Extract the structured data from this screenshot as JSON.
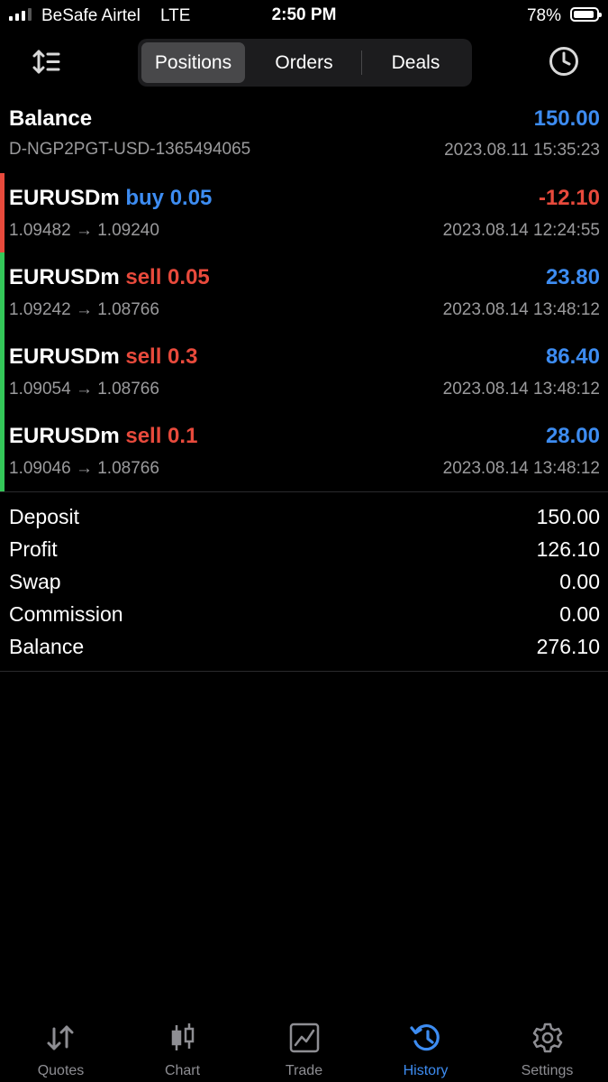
{
  "status_bar": {
    "carrier": "BeSafe Airtel",
    "network": "LTE",
    "time": "2:50 PM",
    "battery_percent": "78%",
    "battery_level": 0.78
  },
  "top_nav": {
    "sort_icon": "sort-icon",
    "clock_icon": "history-clock-icon",
    "tabs": [
      {
        "label": "Positions",
        "active": true
      },
      {
        "label": "Orders",
        "active": false
      },
      {
        "label": "Deals",
        "active": false
      }
    ]
  },
  "balance_entry": {
    "label": "Balance",
    "account": "D-NGP2PGT-USD-1365494065",
    "amount": "150.00",
    "datetime": "2023.08.11 15:35:23"
  },
  "deals": [
    {
      "symbol": "EURUSDm",
      "side_volume": "buy 0.05",
      "side": "buy",
      "prices": "1.09482 → 1.09240",
      "profit": "-12.10",
      "datetime": "2023.08.14 12:24:55"
    },
    {
      "symbol": "EURUSDm",
      "side_volume": "sell 0.05",
      "side": "sell",
      "prices": "1.09242 → 1.08766",
      "profit": "23.80",
      "datetime": "2023.08.14 13:48:12"
    },
    {
      "symbol": "EURUSDm",
      "side_volume": "sell 0.3",
      "side": "sell",
      "prices": "1.09054 → 1.08766",
      "profit": "86.40",
      "datetime": "2023.08.14 13:48:12"
    },
    {
      "symbol": "EURUSDm",
      "side_volume": "sell 0.1",
      "side": "sell",
      "prices": "1.09046 → 1.08766",
      "profit": "28.00",
      "datetime": "2023.08.14 13:48:12"
    }
  ],
  "summary": [
    {
      "label": "Deposit",
      "value": "150.00"
    },
    {
      "label": "Profit",
      "value": "126.10"
    },
    {
      "label": "Swap",
      "value": "0.00"
    },
    {
      "label": "Commission",
      "value": "0.00"
    },
    {
      "label": "Balance",
      "value": "276.10"
    }
  ],
  "tab_bar": [
    {
      "label": "Quotes",
      "icon": "quotes-arrows-icon",
      "active": false
    },
    {
      "label": "Chart",
      "icon": "candlestick-chart-icon",
      "active": false
    },
    {
      "label": "Trade",
      "icon": "trade-chart-icon",
      "active": false
    },
    {
      "label": "History",
      "icon": "history-clock-icon",
      "active": true
    },
    {
      "label": "Settings",
      "icon": "gear-icon",
      "active": false
    }
  ],
  "colors": {
    "blue": "#3d8cf1",
    "red": "#e84a3c",
    "loss_bar": "#e84a3c",
    "profit_bar": "#34c759",
    "muted": "#9a9a9c"
  }
}
